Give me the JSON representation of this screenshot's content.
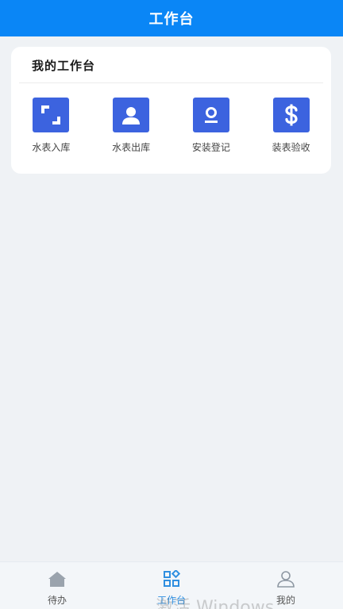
{
  "header": {
    "title": "工作台"
  },
  "card": {
    "title": "我的工作台",
    "items": [
      {
        "label": "水表入库",
        "icon": "scan-frame-icon"
      },
      {
        "label": "水表出库",
        "icon": "user-portrait-icon"
      },
      {
        "label": "安装登记",
        "icon": "id-badge-icon"
      },
      {
        "label": "装表验收",
        "icon": "dollar-icon"
      }
    ]
  },
  "tabbar": {
    "items": [
      {
        "label": "待办",
        "icon": "home-icon",
        "active": false
      },
      {
        "label": "工作台",
        "icon": "grid-icon",
        "active": true
      },
      {
        "label": "我的",
        "icon": "person-icon",
        "active": false
      }
    ]
  },
  "watermark": "激活 Windows",
  "colors": {
    "header_bg": "#0a86f6",
    "tile_bg": "#3c63df",
    "active_tab": "#2f8fe0",
    "page_bg": "#eff2f5"
  }
}
